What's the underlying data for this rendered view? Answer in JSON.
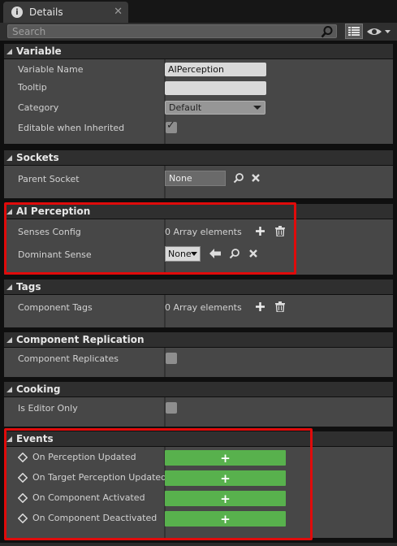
{
  "tab": {
    "title": "Details",
    "close": "✕",
    "icon": "info-icon"
  },
  "search": {
    "placeholder": "Search"
  },
  "categories": {
    "variable": "Variable",
    "sockets": "Sockets",
    "ai_perception": "AI Perception",
    "tags": "Tags",
    "component_replication": "Component Replication",
    "cooking": "Cooking",
    "events": "Events"
  },
  "variable": {
    "name_label": "Variable Name",
    "name_value": "AIPerception",
    "tooltip_label": "Tooltip",
    "tooltip_value": "",
    "category_label": "Category",
    "category_value": "Default",
    "editable_label": "Editable when Inherited",
    "editable_checked": true
  },
  "sockets": {
    "parent_label": "Parent Socket",
    "parent_value": "None"
  },
  "ai_perception": {
    "senses_label": "Senses Config",
    "senses_value": "0 Array elements",
    "dominant_label": "Dominant Sense",
    "dominant_value": "None"
  },
  "tags": {
    "component_tags_label": "Component Tags",
    "component_tags_value": "0 Array elements"
  },
  "component_replication": {
    "replicates_label": "Component Replicates",
    "replicates_checked": false
  },
  "cooking": {
    "editor_only_label": "Is Editor Only",
    "editor_only_checked": false
  },
  "events": {
    "items": [
      {
        "label": "On Perception Updated"
      },
      {
        "label": "On Target Perception Updated"
      },
      {
        "label": "On Component Activated"
      },
      {
        "label": "On Component Deactivated"
      }
    ],
    "button_symbol": "+"
  },
  "colors": {
    "highlight": "#e00b0b",
    "event_button": "#58b14d",
    "panel": "#474747",
    "header": "#2f2f2f"
  }
}
